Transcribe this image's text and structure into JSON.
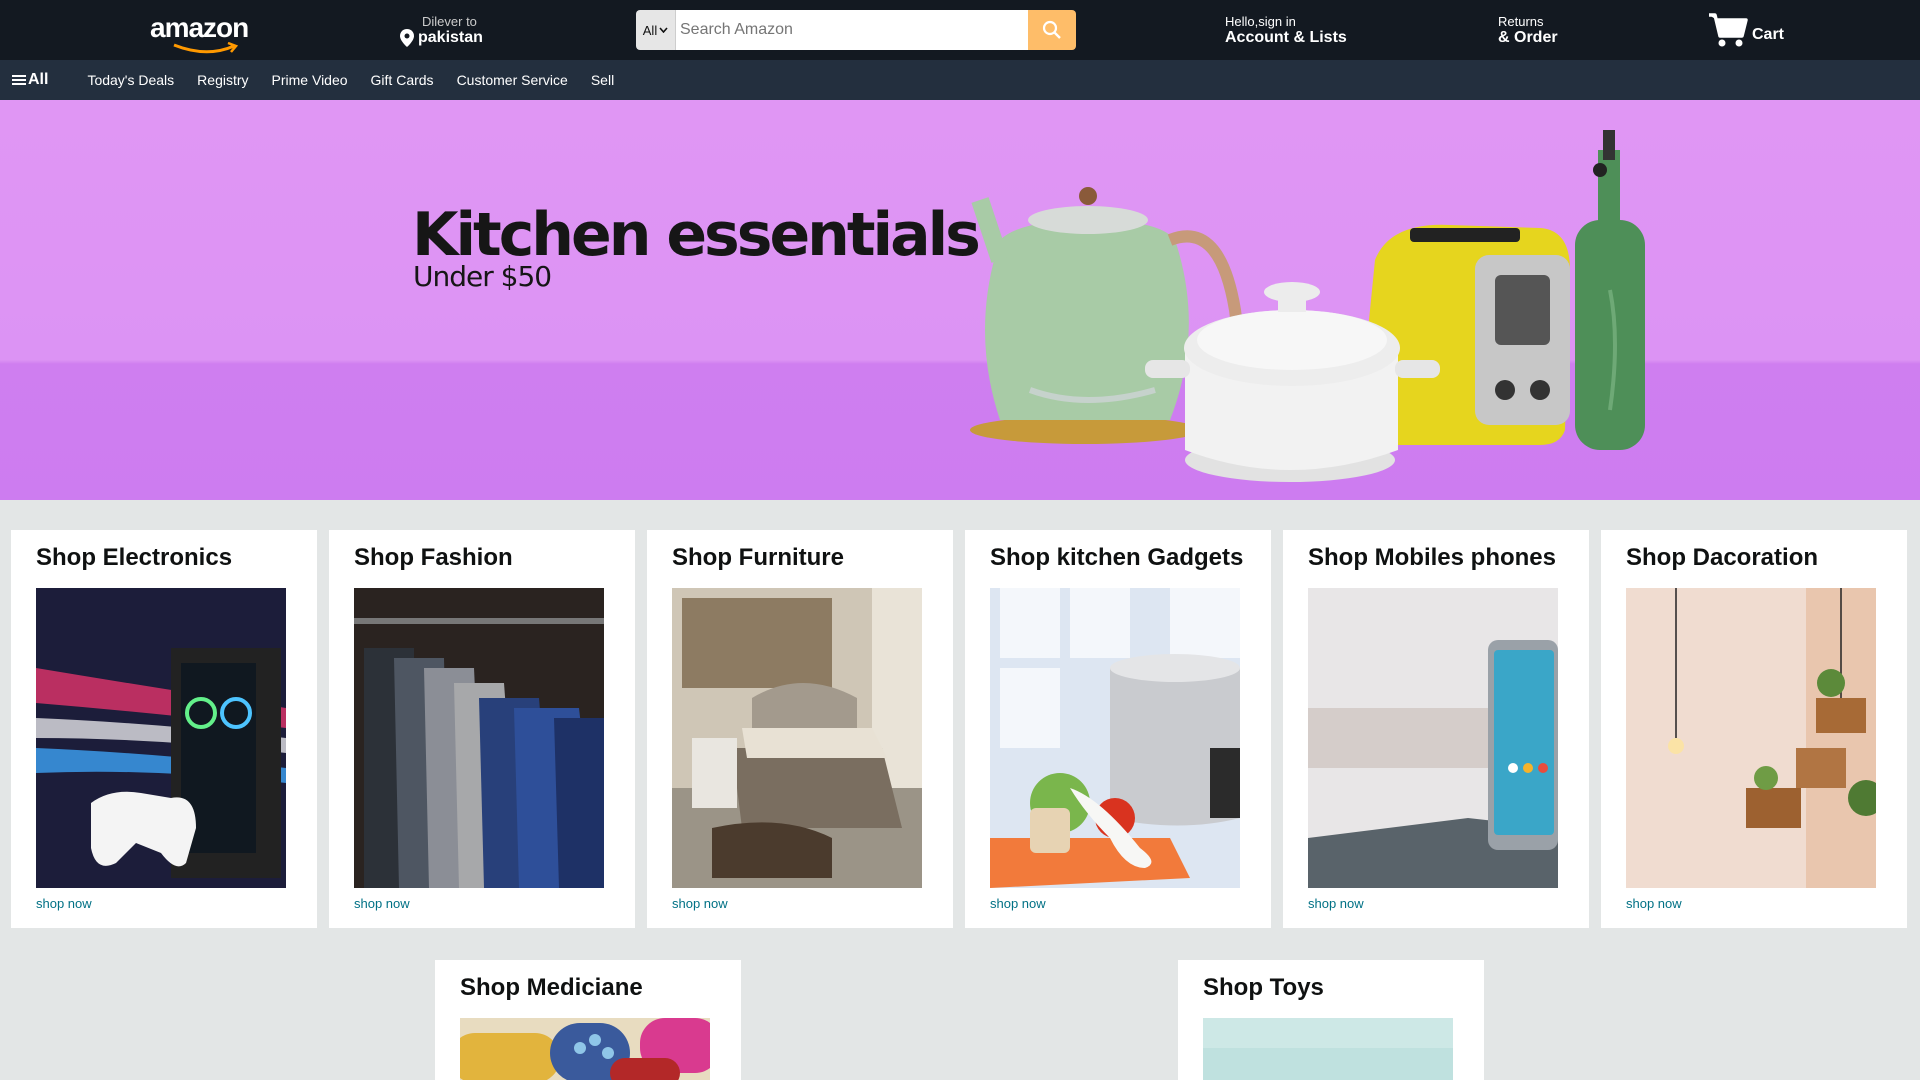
{
  "header": {
    "logo_text": "amazon",
    "deliver_to": "Dilever to",
    "location": "pakistan",
    "search_category": "All",
    "search_placeholder": "Search Amazon",
    "account_line1": "Hello,sign in",
    "account_line2": "Account & Lists",
    "returns_line1": "Returns",
    "returns_line2": "& Order",
    "cart_label": "Cart"
  },
  "subnav": {
    "all_label": "All",
    "items": [
      "Today's Deals",
      "Registry",
      "Prime Video",
      "Gift Cards",
      "Customer Service",
      "Sell"
    ]
  },
  "hero": {
    "title": "Kitchen essentials",
    "subtitle": "Under $50"
  },
  "cards": [
    {
      "title": "Shop Electronics",
      "link": "shop now"
    },
    {
      "title": "Shop Fashion",
      "link": "shop now"
    },
    {
      "title": "Shop Furniture",
      "link": "shop now"
    },
    {
      "title": "Shop kitchen Gadgets",
      "link": "shop now"
    },
    {
      "title": "Shop Mobiles phones",
      "link": "shop now"
    },
    {
      "title": "Shop Dacoration",
      "link": "shop now"
    },
    {
      "title": "Shop Mediciane",
      "link": ""
    },
    {
      "title": "Shop Toys",
      "link": ""
    }
  ],
  "colors": {
    "nav_bg": "#131921",
    "subnav_bg": "#232f3e",
    "search_button": "#febd69",
    "hero_bg": "#e096f4",
    "link": "#007185",
    "page_bg": "#e3e6e6"
  }
}
